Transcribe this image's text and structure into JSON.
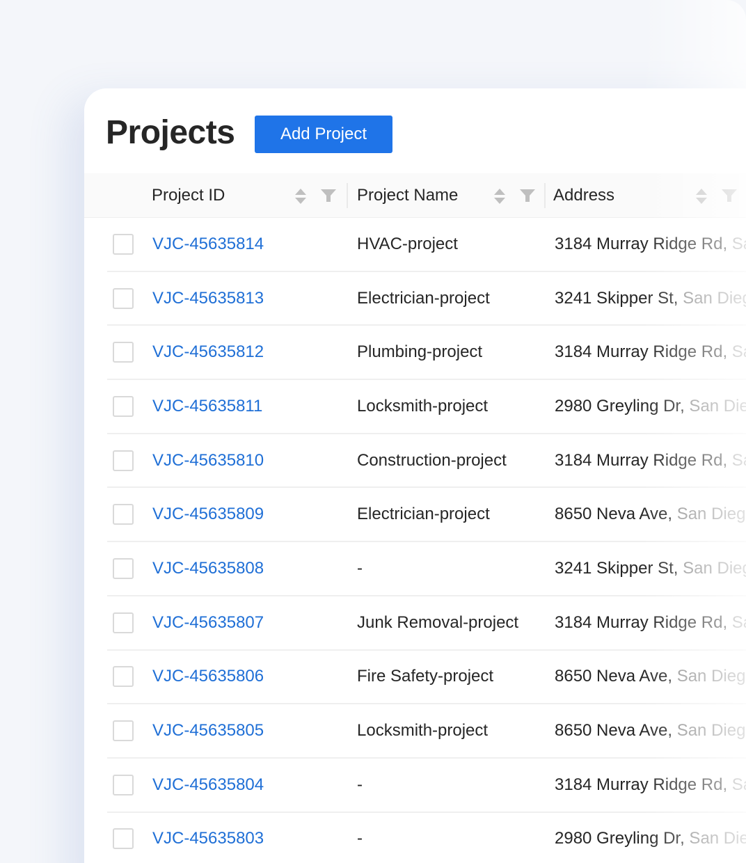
{
  "page": {
    "title": "Projects",
    "add_button_label": "Add Project"
  },
  "table": {
    "columns": [
      {
        "label": "Project ID",
        "sortable": true,
        "filterable": true
      },
      {
        "label": "Project Name",
        "sortable": true,
        "filterable": true
      },
      {
        "label": "Address",
        "sortable": true,
        "filterable": true
      }
    ],
    "rows": [
      {
        "id": "VJC-45635814",
        "name": "HVAC-project",
        "street": "3184 Murray Ridge Rd,",
        "city": " San Diego"
      },
      {
        "id": "VJC-45635813",
        "name": "Electrician-project",
        "street": "3241 Skipper St,",
        "city": " San Diego"
      },
      {
        "id": "VJC-45635812",
        "name": "Plumbing-project",
        "street": "3184 Murray Ridge Rd,",
        "city": " San Diego"
      },
      {
        "id": "VJC-45635811",
        "name": "Locksmith-project",
        "street": "2980 Greyling Dr,",
        "city": " San Diego"
      },
      {
        "id": "VJC-45635810",
        "name": "Construction-project",
        "street": "3184 Murray Ridge Rd,",
        "city": " San Diego"
      },
      {
        "id": "VJC-45635809",
        "name": "Electrician-project",
        "street": "8650 Neva Ave,",
        "city": " San Diego"
      },
      {
        "id": "VJC-45635808",
        "name": "-",
        "street": "3241 Skipper St,",
        "city": " San Diego"
      },
      {
        "id": "VJC-45635807",
        "name": "Junk Removal-project",
        "street": "3184 Murray Ridge Rd,",
        "city": " San Diego"
      },
      {
        "id": "VJC-45635806",
        "name": "Fire Safety-project",
        "street": "8650 Neva Ave,",
        "city": " San Diego"
      },
      {
        "id": "VJC-45635805",
        "name": "Locksmith-project",
        "street": "8650 Neva Ave,",
        "city": " San Diego"
      },
      {
        "id": "VJC-45635804",
        "name": "-",
        "street": "3184 Murray Ridge Rd,",
        "city": " San Diego"
      },
      {
        "id": "VJC-45635803",
        "name": "-",
        "street": "2980 Greyling Dr,",
        "city": " San Diego"
      }
    ]
  },
  "colors": {
    "primary": "#1f74e8",
    "link": "#1f6fd6",
    "text": "#262626",
    "muted_text": "#8a8a8a",
    "page_background": "#f4f6fa",
    "header_background": "#fafafa"
  },
  "icons": {
    "sort": "sort-icon",
    "filter": "filter-icon",
    "checkbox": "checkbox"
  }
}
